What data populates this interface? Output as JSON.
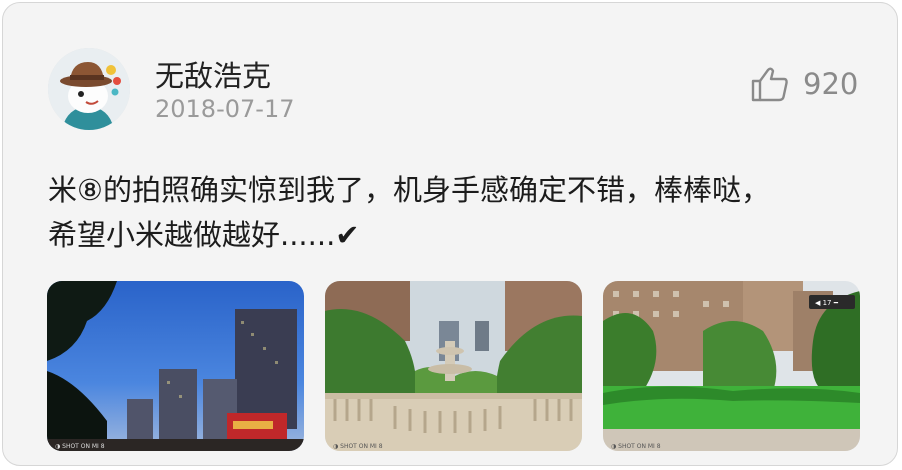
{
  "post": {
    "author": "无敌浩克",
    "date": "2018-07-17",
    "like_count": "920",
    "text_line1": "米⑧的拍照确实惊到我了，机身手感确定不错，棒棒哒，",
    "text_line2": "希望小米越做越好......✔"
  },
  "icons": {
    "like": "thumbs-up-outline-icon",
    "avatar": "cartoon-avatar-with-hat"
  },
  "photos": [
    {
      "subject": "night buildings under blue sky"
    },
    {
      "subject": "fountain with stone balustrade"
    },
    {
      "subject": "garden lawn with apartment buildings"
    }
  ],
  "colors": {
    "card_bg": "#f4f4f4",
    "muted_text": "#9a9a9a",
    "body_text": "#1c1c1c"
  }
}
